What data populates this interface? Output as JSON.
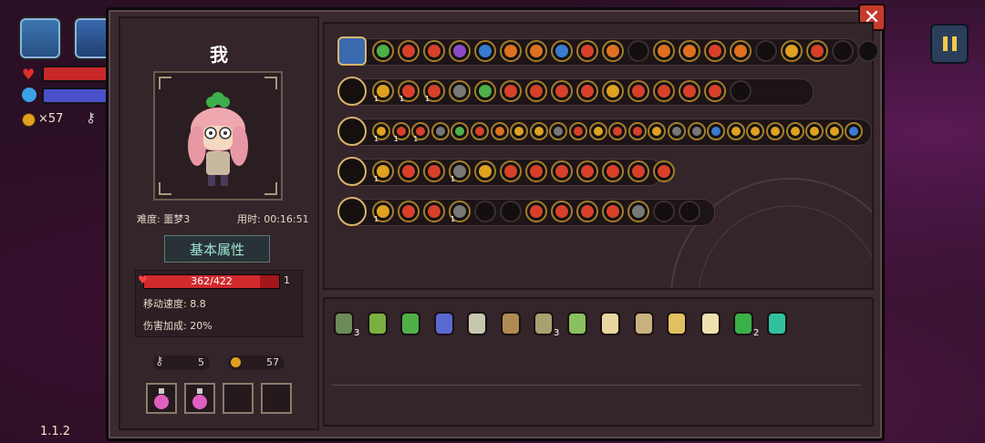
{
  "hud": {
    "coins": "×57",
    "version": "1.1.2",
    "health_fill": 0.86,
    "mana_fill": 0.8
  },
  "player": {
    "name": "我",
    "difficulty": "难度: 噩梦3",
    "time": "用时: 00:16:51"
  },
  "attributes": {
    "title": "基本属性",
    "hp": "362/422",
    "hp_fraction": 0.858,
    "hp_extra": "1",
    "move_speed": "移动速度: 8.8",
    "damage_bonus": "伤害加成: 20%"
  },
  "resources": {
    "keys": "5",
    "coins": "57"
  },
  "potions": [
    "pink-potion",
    "pink-potion",
    "empty",
    "empty"
  ],
  "colors": {
    "gold": "#e0a020",
    "red": "#d8402a",
    "green": "#4fb04a",
    "blue": "#3a7ad0",
    "purple": "#8a4ac8",
    "teal": "#2ab0a0",
    "orange": "#e07020",
    "gray": "#777777"
  },
  "weapon_rows": [
    {
      "weapon": "treasure-chest",
      "items": [
        "green",
        "red",
        "red",
        "purple",
        "blue",
        "orange",
        "orange",
        "blue",
        "red",
        "orange",
        "empty",
        "orange",
        "orange",
        "red",
        "orange",
        "empty",
        "gold",
        "red",
        "empty",
        "empty"
      ]
    },
    {
      "weapon": "magic-staff",
      "items": [
        "gold",
        "red",
        "red",
        "gray",
        "green",
        "red",
        "red",
        "red",
        "red",
        "gold",
        "red",
        "red",
        "red",
        "red",
        "empty"
      ]
    },
    {
      "weapon": "golden-staff",
      "items": [
        "gold",
        "red",
        "red",
        "gray",
        "green",
        "red",
        "orange",
        "gold",
        "gold",
        "gray",
        "red",
        "gold",
        "red",
        "red",
        "gold",
        "gray",
        "gray",
        "blue",
        "gold",
        "gold",
        "gold",
        "gold",
        "gold",
        "gold",
        "blue"
      ]
    },
    {
      "weapon": "red-staff",
      "items": [
        "gold",
        "red",
        "red",
        "gray",
        "gold",
        "red",
        "red",
        "red",
        "red",
        "red",
        "red",
        "red"
      ]
    },
    {
      "weapon": "gauntlet",
      "items": [
        "gold",
        "red",
        "red",
        "gray",
        "empty",
        "empty",
        "red",
        "red",
        "red",
        "red",
        "gray",
        "empty",
        "empty"
      ]
    }
  ],
  "level_badges": [
    {
      "row": 1,
      "slot": 0,
      "text": "1"
    },
    {
      "row": 1,
      "slot": 1,
      "text": "1"
    },
    {
      "row": 1,
      "slot": 2,
      "text": "1"
    },
    {
      "row": 2,
      "slot": 0,
      "text": "1"
    },
    {
      "row": 2,
      "slot": 1,
      "text": "1"
    },
    {
      "row": 2,
      "slot": 2,
      "text": "1"
    },
    {
      "row": 3,
      "slot": 0,
      "text": "1"
    },
    {
      "row": 3,
      "slot": 3,
      "text": "1"
    },
    {
      "row": 4,
      "slot": 0,
      "text": "1"
    },
    {
      "row": 4,
      "slot": 3,
      "text": "1"
    }
  ],
  "relics": [
    {
      "name": "cloak-relic",
      "color": "#6b8a5a",
      "count": "3"
    },
    {
      "name": "boot-relic",
      "color": "#7ab040",
      "count": ""
    },
    {
      "name": "green-hat-relic",
      "color": "#4fb04a",
      "count": ""
    },
    {
      "name": "jellyfish-relic",
      "color": "#5a6ad0",
      "count": ""
    },
    {
      "name": "insect-relic",
      "color": "#c8c8b0",
      "count": ""
    },
    {
      "name": "bottle-relic",
      "color": "#b08a50",
      "count": ""
    },
    {
      "name": "hook-relic",
      "color": "#a8a070",
      "count": "3"
    },
    {
      "name": "leaf-relic",
      "color": "#8ac060",
      "count": ""
    },
    {
      "name": "bone-relic",
      "color": "#e8d8a0",
      "count": ""
    },
    {
      "name": "key-relic",
      "color": "#c8b080",
      "count": ""
    },
    {
      "name": "goggles-relic",
      "color": "#e0c060",
      "count": ""
    },
    {
      "name": "teeth-relic",
      "color": "#f0e0b0",
      "count": ""
    },
    {
      "name": "clover-relic",
      "color": "#3ab04a",
      "count": "2"
    },
    {
      "name": "fan-relic",
      "color": "#30c0a0",
      "count": ""
    }
  ]
}
